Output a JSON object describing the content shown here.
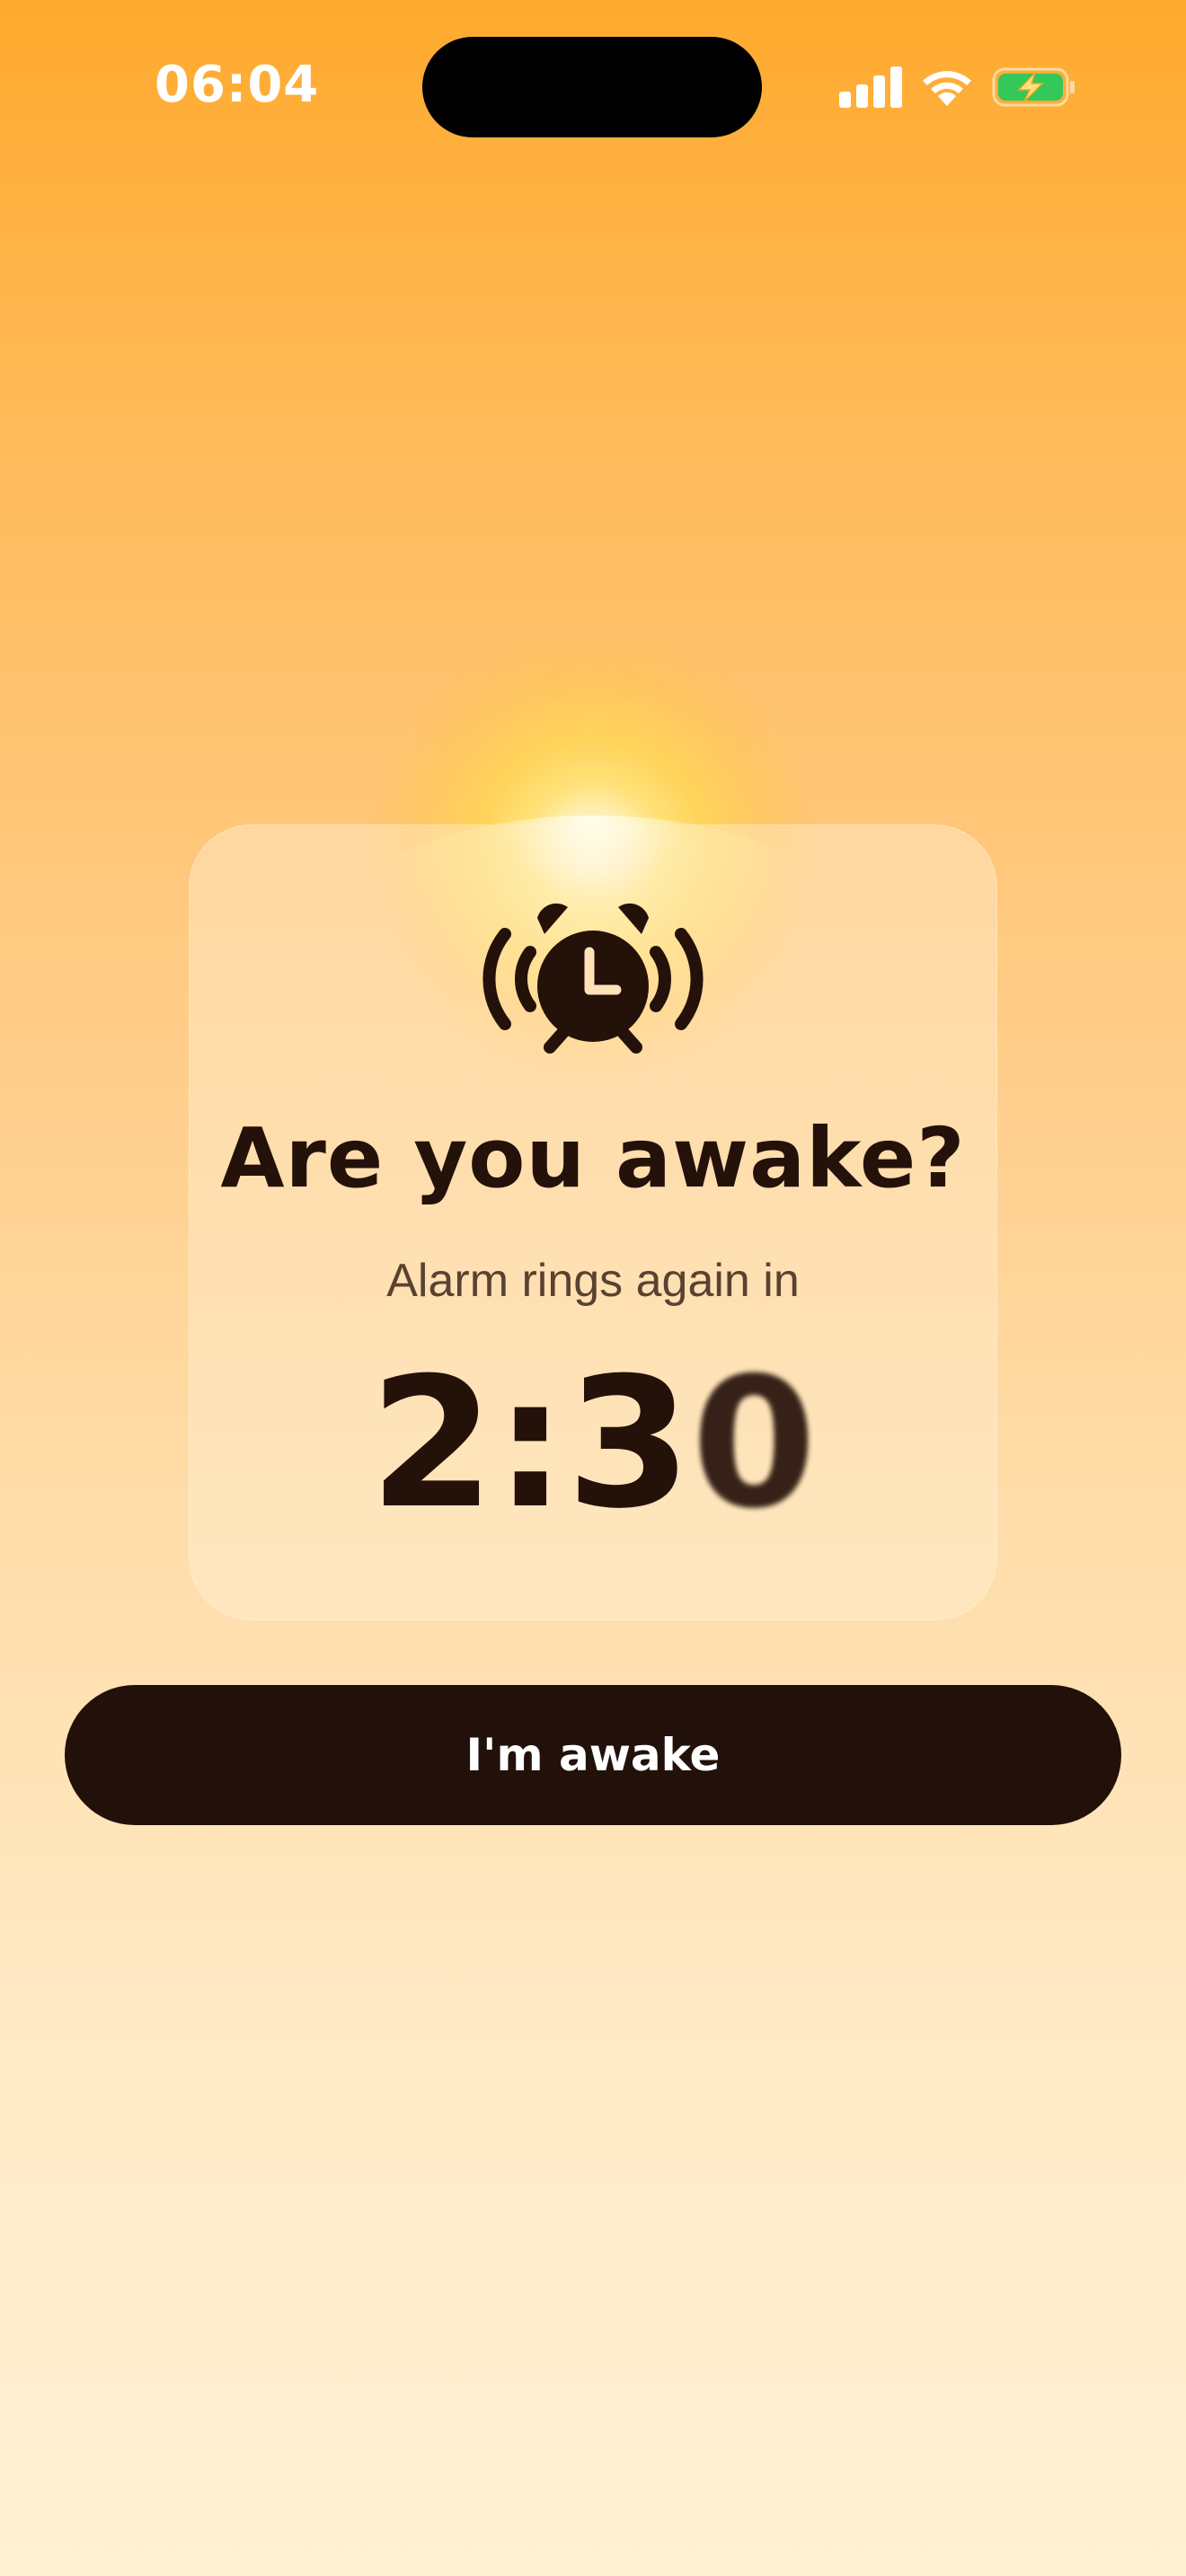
{
  "status_bar": {
    "time": "06:04",
    "signal_icon": "cellular-signal-icon",
    "wifi_icon": "wifi-icon",
    "battery_icon": "battery-charging-icon",
    "battery_color": "#34C759"
  },
  "card": {
    "icon": "alarm-clock-ringing-icon",
    "title": "Are you awake?",
    "subtitle": "Alarm rings again in",
    "countdown_main": "2:3",
    "countdown_last": "0"
  },
  "button": {
    "label": "I'm awake"
  },
  "colors": {
    "background_top": "#FFAA2E",
    "background_bottom": "#FFF1D4",
    "text_dark": "#24110A",
    "button_bg": "#22110A"
  }
}
